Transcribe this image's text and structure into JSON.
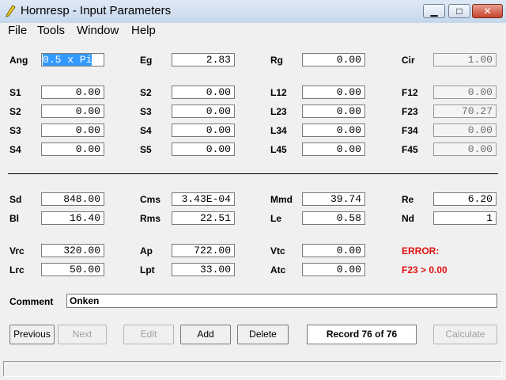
{
  "window": {
    "title": "Hornresp - Input Parameters"
  },
  "menu": [
    "File",
    "Tools",
    "Window",
    "Help"
  ],
  "params": {
    "Ang": "0.5 x Pi",
    "Eg": "2.83",
    "Rg": "0.00",
    "Cir": "1.00",
    "S1": "0.00",
    "S2": "0.00",
    "S3": "0.00",
    "S4": "0.00",
    "S5": "0.00",
    "L12": "0.00",
    "L23": "0.00",
    "L34": "0.00",
    "L45": "0.00",
    "F12": "0.00",
    "F23": "70.27",
    "F34": "0.00",
    "F45": "0.00",
    "Sd": "848.00",
    "Bl": "16.40",
    "Cms": "3.43E-04",
    "Rms": "22.51",
    "Mmd": "39.74",
    "Le": "0.58",
    "Re": "6.20",
    "Nd": "1",
    "Vrc": "320.00",
    "Lrc": "50.00",
    "Ap": "722.00",
    "Lpt": "33.00",
    "Vtc": "0.00",
    "Atc": "0.00"
  },
  "labels": {
    "Ang": "Ang",
    "Eg": "Eg",
    "Rg": "Rg",
    "Cir": "Cir",
    "S1": "S1",
    "S2a": "S2",
    "S3a": "S3",
    "S4a": "S4",
    "S2b": "S2",
    "S3b": "S3",
    "S4b": "S4",
    "S5": "S5",
    "L12": "L12",
    "L23": "L23",
    "L34": "L34",
    "L45": "L45",
    "F12": "F12",
    "F23": "F23",
    "F34": "F34",
    "F45": "F45",
    "Sd": "Sd",
    "Bl": "Bl",
    "Cms": "Cms",
    "Rms": "Rms",
    "Mmd": "Mmd",
    "Le": "Le",
    "Re": "Re",
    "Nd": "Nd",
    "Vrc": "Vrc",
    "Lrc": "Lrc",
    "Ap": "Ap",
    "Lpt": "Lpt",
    "Vtc": "Vtc",
    "Atc": "Atc"
  },
  "left_s": {
    "S1": "0.00",
    "S2": "0.00",
    "S3": "0.00",
    "S4": "0.00"
  },
  "error": {
    "title": "ERROR:",
    "message": "F23 > 0.00"
  },
  "comment": {
    "label": "Comment",
    "value": "Onken"
  },
  "buttons": {
    "previous": "Previous",
    "next": "Next",
    "edit": "Edit",
    "add": "Add",
    "delete": "Delete",
    "calculate": "Calculate"
  },
  "record": "Record 76 of 76",
  "colors": {
    "error": "#e01010",
    "selection": "#3399ff"
  }
}
